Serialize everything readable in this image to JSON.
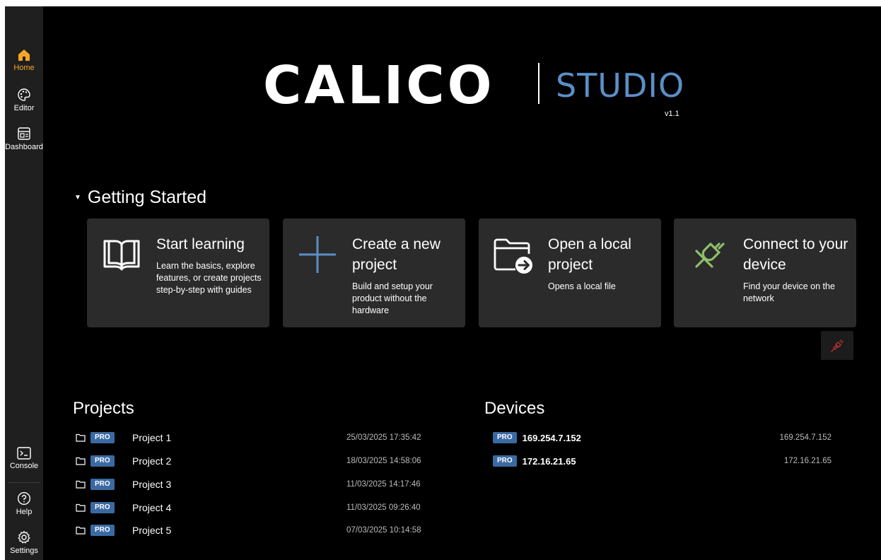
{
  "sidebar": {
    "items": [
      {
        "label": "Home",
        "icon": "home-icon",
        "active": true
      },
      {
        "label": "Editor",
        "icon": "palette-icon"
      },
      {
        "label": "Dashboard",
        "icon": "dashboard-icon"
      }
    ],
    "bottom_items": [
      {
        "label": "Console",
        "icon": "terminal-icon"
      },
      {
        "label": "Help",
        "icon": "help-icon"
      },
      {
        "label": "Settings",
        "icon": "gear-icon"
      }
    ]
  },
  "logo": {
    "main": "CALICO",
    "sub": "STUDIO",
    "version": "v1.1"
  },
  "getting_started": {
    "title": "Getting Started",
    "cards": [
      {
        "title": "Start learning",
        "description": "Learn the basics, explore features, or create projects step-by-step with guides",
        "icon": "book-icon"
      },
      {
        "title": "Create a new project",
        "description": "Build and setup your product without the hardware",
        "icon": "plus-icon"
      },
      {
        "title": "Open a local project",
        "description": "Opens a local file",
        "icon": "folder-open-icon"
      },
      {
        "title": "Connect to your device",
        "description": "Find your device on the network",
        "icon": "plug-icon"
      }
    ]
  },
  "projects": {
    "title": "Projects",
    "badge": "PRO",
    "rows": [
      {
        "name": "Project 1",
        "date": "25/03/2025 17:35:42"
      },
      {
        "name": "Project 2",
        "date": "18/03/2025 14:58:06"
      },
      {
        "name": "Project 3",
        "date": "11/03/2025 14:17:46"
      },
      {
        "name": "Project 4",
        "date": "11/03/2025 09:26:40"
      },
      {
        "name": "Project 5",
        "date": "07/03/2025 10:14:58"
      }
    ]
  },
  "devices": {
    "title": "Devices",
    "badge": "PRO",
    "rows": [
      {
        "name": "169.254.7.152",
        "ip": "169.254.7.152"
      },
      {
        "name": "172.16.21.65",
        "ip": "172.16.21.65"
      }
    ]
  },
  "colors": {
    "accent": "#f5a623",
    "studio_blue": "#5b8fc7",
    "pro_badge": "#3a6aa3",
    "plug_green": "#8fbf6a",
    "disconnect_red": "#b03030"
  }
}
